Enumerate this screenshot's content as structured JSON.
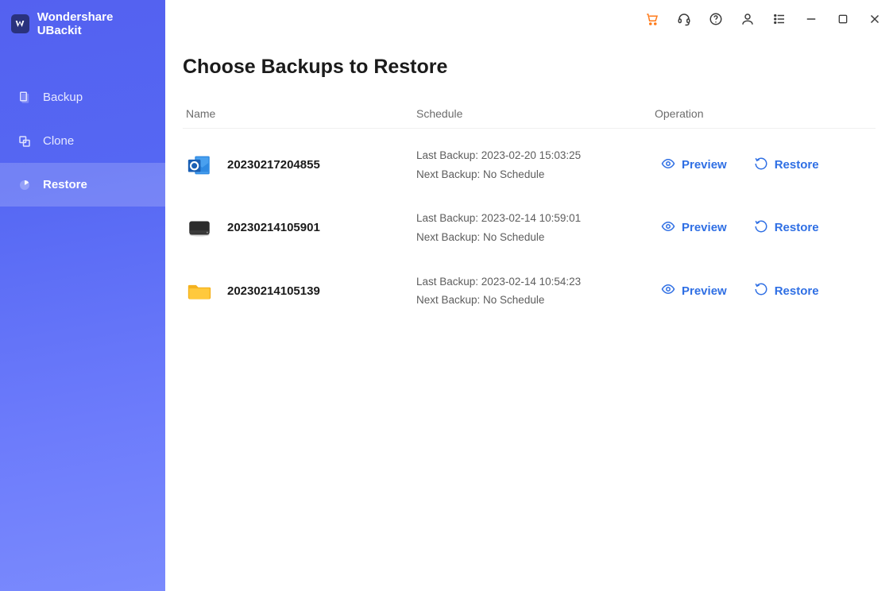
{
  "app": {
    "title": "Wondershare UBackit"
  },
  "toolbar": {
    "icons": [
      "cart",
      "support",
      "help",
      "account",
      "menu",
      "minimize",
      "maximize",
      "close"
    ]
  },
  "sidebar": {
    "items": [
      {
        "label": "Backup",
        "icon": "backup-icon",
        "active": false
      },
      {
        "label": "Clone",
        "icon": "clone-icon",
        "active": false
      },
      {
        "label": "Restore",
        "icon": "restore-icon",
        "active": true
      }
    ]
  },
  "page": {
    "title": "Choose Backups to Restore",
    "columns": {
      "name": "Name",
      "schedule": "Schedule",
      "operation": "Operation"
    },
    "labels": {
      "lastBackupPrefix": "Last Backup: ",
      "nextBackupPrefix": "Next Backup: ",
      "preview": "Preview",
      "restore": "Restore"
    },
    "rows": [
      {
        "icon": "outlook",
        "name": "20230217204855",
        "lastBackup": "2023-02-20 15:03:25",
        "nextBackup": "No Schedule"
      },
      {
        "icon": "disk",
        "name": "20230214105901",
        "lastBackup": "2023-02-14 10:59:01",
        "nextBackup": "No Schedule"
      },
      {
        "icon": "folder",
        "name": "20230214105139",
        "lastBackup": "2023-02-14 10:54:23",
        "nextBackup": "No Schedule"
      }
    ]
  }
}
